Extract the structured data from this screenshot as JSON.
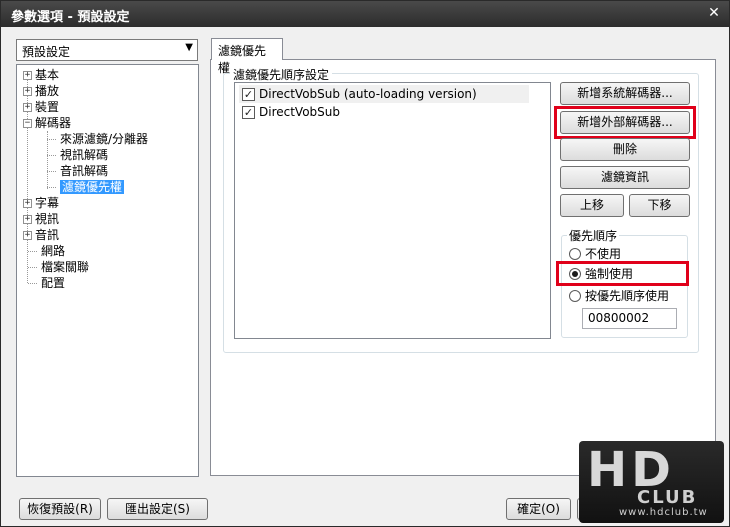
{
  "window": {
    "title": "參數選項 - 預設設定",
    "close_glyph": "✕"
  },
  "preset_select": {
    "value": "預設設定"
  },
  "tree": {
    "items": [
      {
        "label": "基本",
        "expander": "+"
      },
      {
        "label": "播放",
        "expander": "+"
      },
      {
        "label": "裝置",
        "expander": "+"
      },
      {
        "label": "解碼器",
        "expander": "−"
      },
      {
        "label": "來源濾鏡/分離器"
      },
      {
        "label": "視訊解碼"
      },
      {
        "label": "音訊解碼"
      },
      {
        "label": "濾鏡優先權"
      },
      {
        "label": "字幕",
        "expander": "+"
      },
      {
        "label": "視訊",
        "expander": "+"
      },
      {
        "label": "音訊",
        "expander": "+"
      },
      {
        "label": "網路"
      },
      {
        "label": "檔案關聯"
      },
      {
        "label": "配置"
      }
    ]
  },
  "tab": {
    "label": "濾鏡優先權"
  },
  "filter_group": {
    "label": "濾鏡優先順序設定",
    "filters": [
      {
        "name": "DirectVobSub (auto-loading version)",
        "checked": true
      },
      {
        "name": "DirectVobSub",
        "checked": true
      }
    ]
  },
  "buttons": {
    "add_system_decoder": "新增系統解碼器...",
    "add_external_decoder": "新增外部解碼器...",
    "delete": "刪除",
    "filter_info": "濾鏡資訊",
    "move_up": "上移",
    "move_down": "下移"
  },
  "priority": {
    "label": "優先順序",
    "options": [
      "不使用",
      "強制使用",
      "按優先順序使用"
    ],
    "selected": "強制使用",
    "value": "00800002"
  },
  "bottom": {
    "reset": "恢復預設(R)",
    "export": "匯出設定(S)",
    "ok": "確定(O)",
    "cancel": "取消"
  },
  "watermark": {
    "big": "HD",
    "mid": "CLUB",
    "small": "www.hdclub.tw"
  },
  "colors": {
    "highlight_box": "#e0001a",
    "selection": "#3399ff"
  }
}
